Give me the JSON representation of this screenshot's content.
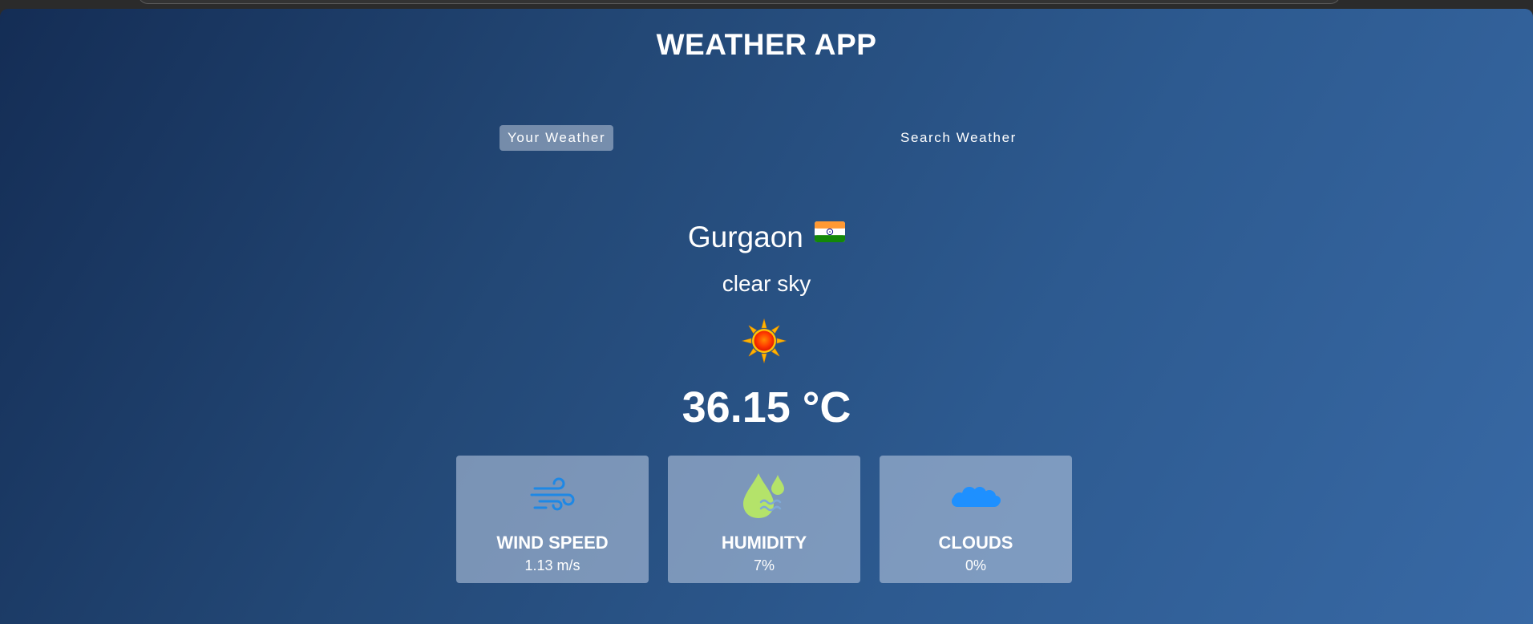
{
  "app": {
    "title": "WEATHER APP"
  },
  "tabs": [
    {
      "label": "Your Weather",
      "active": true
    },
    {
      "label": "Search Weather",
      "active": false
    }
  ],
  "weather": {
    "city": "Gurgaon",
    "country_flag_icon": "flag-india-icon",
    "description": "clear sky",
    "condition_icon": "sun-icon",
    "temperature": "36.15 °C"
  },
  "cards": [
    {
      "icon": "wind-icon",
      "label": "WIND SPEED",
      "value": "1.13 m/s"
    },
    {
      "icon": "humidity-icon",
      "label": "HUMIDITY",
      "value": "7%"
    },
    {
      "icon": "clouds-icon",
      "label": "CLOUDS",
      "value": "0%"
    }
  ],
  "colors": {
    "background_start": "#142d55",
    "background_end": "#3869a5",
    "card_bg": "#b4c5de",
    "wind_icon": "#1e88e5",
    "humidity_icon": "#b4e36a",
    "clouds_icon": "#1e90ff"
  }
}
